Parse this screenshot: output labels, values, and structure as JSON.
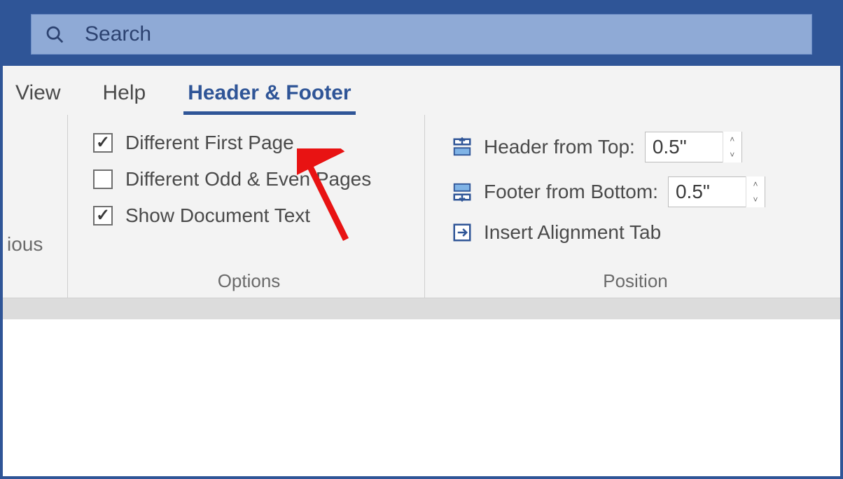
{
  "search": {
    "placeholder": "Search"
  },
  "tabs": {
    "view": "View",
    "help": "Help",
    "headerfooter": "Header & Footer"
  },
  "leading_cut_text": "ious",
  "options": {
    "group_label": "Options",
    "first_page": {
      "label": "Different First Page",
      "checked": true
    },
    "odd_even": {
      "label": "Different Odd & Even Pages",
      "checked": false
    },
    "show_text": {
      "label": "Show Document Text",
      "checked": true
    }
  },
  "position": {
    "group_label": "Position",
    "header_top": {
      "label": "Header from Top:",
      "value": "0.5\""
    },
    "footer_bottom": {
      "label": "Footer from Bottom:",
      "value": "0.5\""
    },
    "align_tab": {
      "label": "Insert Alignment Tab"
    }
  }
}
